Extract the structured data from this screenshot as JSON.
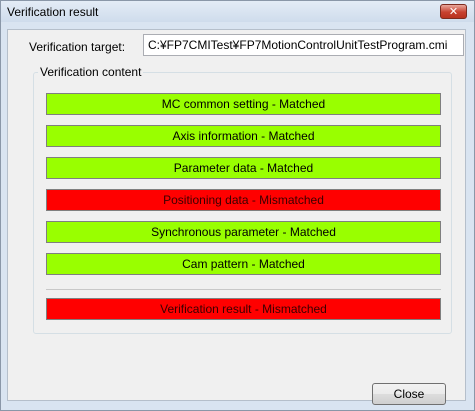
{
  "window": {
    "title": "Verification result",
    "close_glyph": "✕"
  },
  "target": {
    "label": "Verification target:",
    "value": "C:¥FP7CMITest¥FP7MotionControlUnitTestProgram.cmi"
  },
  "content": {
    "legend": "Verification content",
    "items": [
      {
        "label": "MC common setting - Matched",
        "status": "matched"
      },
      {
        "label": "Axis information - Matched",
        "status": "matched"
      },
      {
        "label": "Parameter data - Matched",
        "status": "matched"
      },
      {
        "label": "Positioning data - Mismatched",
        "status": "mismatched"
      },
      {
        "label": "Synchronous parameter - Matched",
        "status": "matched"
      },
      {
        "label": "Cam pattern - Matched",
        "status": "matched"
      }
    ],
    "overall": {
      "label": "Verification result - Mismatched",
      "status": "mismatched"
    }
  },
  "buttons": {
    "close_label": "Close"
  },
  "colors": {
    "matched": "#99ff00",
    "mismatched": "#ff0000"
  }
}
